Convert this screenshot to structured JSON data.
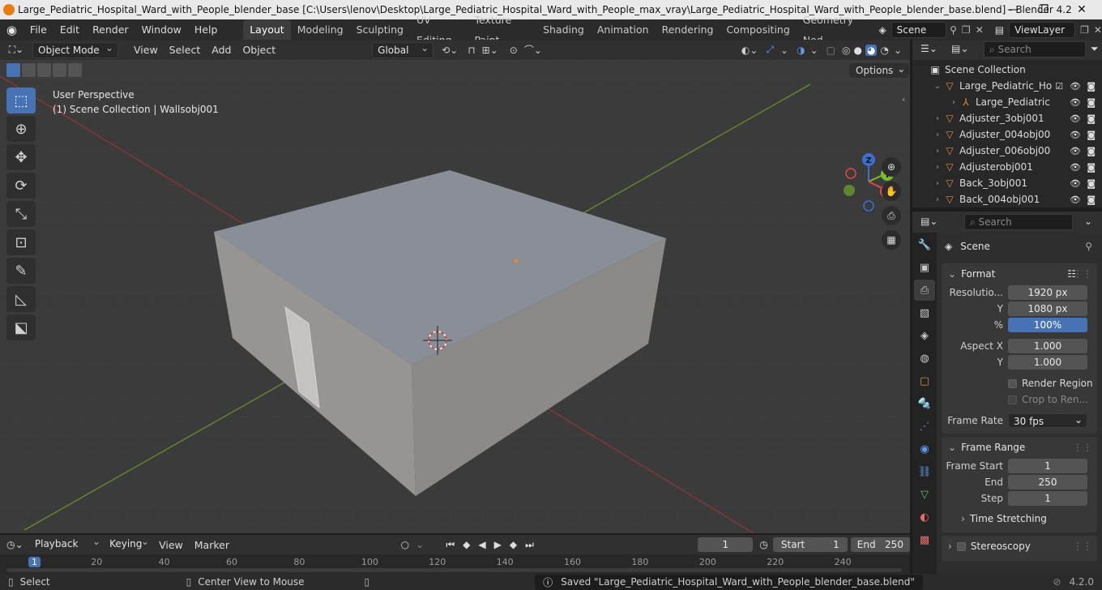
{
  "window": {
    "title": "Large_Pediatric_Hospital_Ward_with_People_blender_base [C:\\Users\\lenov\\Desktop\\Large_Pediatric_Hospital_Ward_with_People_max_vray\\Large_Pediatric_Hospital_Ward_with_People_blender_base.blend] - Blender 4.2"
  },
  "menu": [
    "File",
    "Edit",
    "Render",
    "Window",
    "Help"
  ],
  "workspaces": [
    "Layout",
    "Modeling",
    "Sculpting",
    "UV Editing",
    "Texture Paint",
    "Shading",
    "Animation",
    "Rendering",
    "Compositing",
    "Geometry Nod"
  ],
  "scene_field": "Scene",
  "viewlayer_field": "ViewLayer",
  "viewport_header": {
    "mode": "Object Mode",
    "menus": [
      "View",
      "Select",
      "Add",
      "Object"
    ],
    "transform": "Global",
    "options": "Options"
  },
  "viewport_overlay": {
    "perspective": "User Perspective",
    "context": "(1) Scene Collection | Wallsobj001"
  },
  "gizmo": {
    "x": "X",
    "y": "Y",
    "z": "Z"
  },
  "outliner": {
    "search_placeholder": "Search",
    "root": "Scene Collection",
    "rows": [
      {
        "label": "Large_Pediatric_Ho",
        "indent": 1
      },
      {
        "label": "Large_Pediatric",
        "indent": 2
      },
      {
        "label": "Adjuster_3obj001",
        "indent": 1
      },
      {
        "label": "Adjuster_004obj00",
        "indent": 1
      },
      {
        "label": "Adjuster_006obj00",
        "indent": 1
      },
      {
        "label": "Adjusterobj001",
        "indent": 1
      },
      {
        "label": "Back_3obj001",
        "indent": 1
      },
      {
        "label": "Back_004obj001",
        "indent": 1
      }
    ]
  },
  "properties": {
    "search_placeholder": "Search",
    "context": "Scene",
    "format": {
      "title": "Format",
      "resolution_label": "Resolutio...",
      "res_x": "1920 px",
      "y_label": "Y",
      "res_y": "1080 px",
      "pct_label": "%",
      "pct": "100%",
      "aspect_x_label": "Aspect X",
      "aspect_x": "1.000",
      "aspect_y": "1.000",
      "render_region": "Render Region",
      "crop": "Crop to Ren...",
      "frame_rate_label": "Frame Rate",
      "frame_rate": "30 fps"
    },
    "frame_range": {
      "title": "Frame Range",
      "start_label": "Frame Start",
      "start": "1",
      "end_label": "End",
      "end": "250",
      "step_label": "Step",
      "step": "1"
    },
    "time_stretching": "Time Stretching",
    "stereoscopy": "Stereoscopy"
  },
  "timeline": {
    "menus": [
      "Playback",
      "Keying",
      "View",
      "Marker"
    ],
    "current_frame": "1",
    "start_label": "Start",
    "start": "1",
    "end_label": "End",
    "end": "250",
    "ticks": [
      "1",
      "20",
      "40",
      "60",
      "80",
      "100",
      "120",
      "140",
      "160",
      "180",
      "200",
      "220",
      "240"
    ]
  },
  "status": {
    "select": "Select",
    "center": "Center View to Mouse",
    "message": "Saved \"Large_Pediatric_Hospital_Ward_with_People_blender_base.blend\"",
    "version": "4.2.0"
  }
}
